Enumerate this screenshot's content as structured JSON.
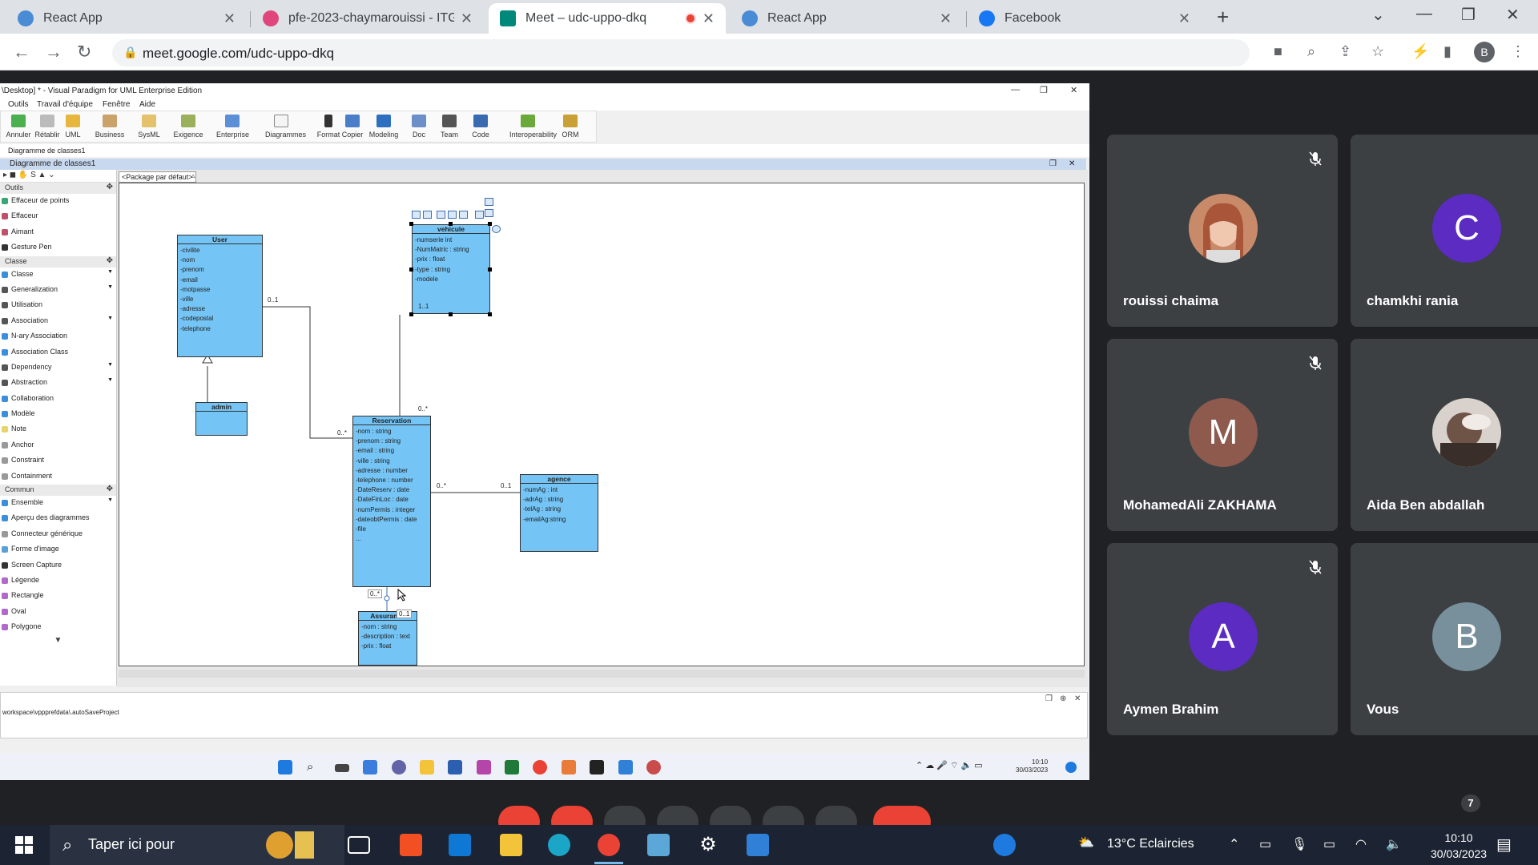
{
  "browser": {
    "tabs": [
      {
        "title": "React App",
        "favicon_color": "#4a8bd6"
      },
      {
        "title": "pfe-2023-chaymarouissi - ITGate",
        "favicon_color": "#e0457b"
      },
      {
        "title": "Meet – udc-uppo-dkq",
        "favicon_color": "#00897b",
        "active": true
      },
      {
        "title": "React App",
        "favicon_color": "#4a8bd6"
      },
      {
        "title": "Facebook",
        "favicon_color": "#1877f2"
      }
    ],
    "url": "meet.google.com/udc-uppo-dkq",
    "profile_initial": "B"
  },
  "visual_paradigm": {
    "window_title": "\\Desktop] * - Visual Paradigm for UML Enterprise Edition",
    "menu": [
      "Outils",
      "Travail d'équipe",
      "Fenêtre",
      "Aide"
    ],
    "ribbon": [
      "Annuler",
      "Rétablir",
      "UML",
      "Business",
      "SysML",
      "Exigence",
      "Enterprise",
      "Diagrammes",
      "Format",
      "Copier",
      "Modeling",
      "Doc",
      "Team",
      "Code",
      "Interoperability",
      "ORM"
    ],
    "diagram_tab": "Diagramme de classes1",
    "diagram_title": "Diagramme de classes1",
    "package_tab": "<Package par défaut>",
    "palette": {
      "sections": [
        {
          "title": "Outils",
          "items": [
            "Effaceur de points",
            "Effaceur",
            "Aimant",
            "Gesture Pen"
          ]
        },
        {
          "title": "Classe",
          "items": [
            "Classe",
            "Generalization",
            "Utilisation",
            "Association",
            "N-ary Association",
            "Association Class",
            "Dependency",
            "Abstraction",
            "Collaboration",
            "Modèle",
            "Note",
            "Anchor",
            "Constraint",
            "Containment"
          ]
        },
        {
          "title": "Commun",
          "items": [
            "Ensemble",
            "Aperçu des diagrammes",
            "Connecteur générique",
            "Forme d'image",
            "Screen Capture",
            "Légende",
            "Rectangle",
            "Oval",
            "Polygone"
          ]
        }
      ]
    },
    "classes": {
      "user": {
        "name": "User",
        "attrs": [
          "-civilite",
          "-nom",
          "-prenom",
          "-email",
          "-motpasse",
          "-ville",
          "-adresse",
          "-codepostal",
          "-telephone"
        ]
      },
      "admin": {
        "name": "admin",
        "attrs": []
      },
      "vehicule": {
        "name": "vehicule",
        "attrs": [
          "-numserie int",
          "-NumMatric : string",
          "-prix : float",
          "-type : string",
          "-modele"
        ]
      },
      "reservation": {
        "name": "Reservation",
        "attrs": [
          "-nom : string",
          "-prenom : string",
          "-email : string",
          "-ville : string",
          "-adresse : number",
          "-telephone : number",
          "-DateReserv : date",
          "-DateFinLoc : date",
          "-numPermis : integer",
          "-dateobtPermis : date",
          "-file",
          "..."
        ]
      },
      "agence": {
        "name": "agence",
        "attrs": [
          "-numAg : int",
          "-adrAg : string",
          "-telAg : string",
          "-emailAg:string"
        ]
      },
      "assurance": {
        "name": "Assurance",
        "attrs": [
          "-nom : string",
          "-description : text",
          "-prix : float"
        ]
      }
    },
    "multiplicities": {
      "user_res": "0..1",
      "res_user": "0..*",
      "veh_res": "1..1",
      "res_veh": "0..*",
      "res_ag": "0..*",
      "ag_res": "0..1",
      "res_ass": "0..*",
      "ass_res": "0..1"
    },
    "bottom_path": "workspace\\vppprefdata\\.autoSaveProject",
    "remote_clock": {
      "time": "10:10",
      "date": "30/03/2023"
    }
  },
  "participants": [
    {
      "name": "rouissi chaima",
      "muted": true,
      "avatar": "photo",
      "color": "#c98a6a"
    },
    {
      "name": "chamkhi rania",
      "muted": false,
      "avatar": "C",
      "color": "#5b2bc2"
    },
    {
      "name": "MohamedAli ZAKHAMA",
      "muted": true,
      "avatar": "M",
      "color": "#8d5a4d"
    },
    {
      "name": "Aida Ben abdallah",
      "muted": false,
      "avatar": "photo",
      "color": "#b9a89c"
    },
    {
      "name": "Aymen Brahim",
      "muted": true,
      "avatar": "A",
      "color": "#5b2bc2"
    },
    {
      "name": "Vous",
      "muted": false,
      "avatar": "B",
      "color": "#78909c"
    }
  ],
  "meet": {
    "participant_count": "7"
  },
  "taskbar": {
    "search_placeholder": "Taper ici pour",
    "weather": "13°C Eclaircies",
    "time": "10:10",
    "date": "30/03/2023"
  }
}
